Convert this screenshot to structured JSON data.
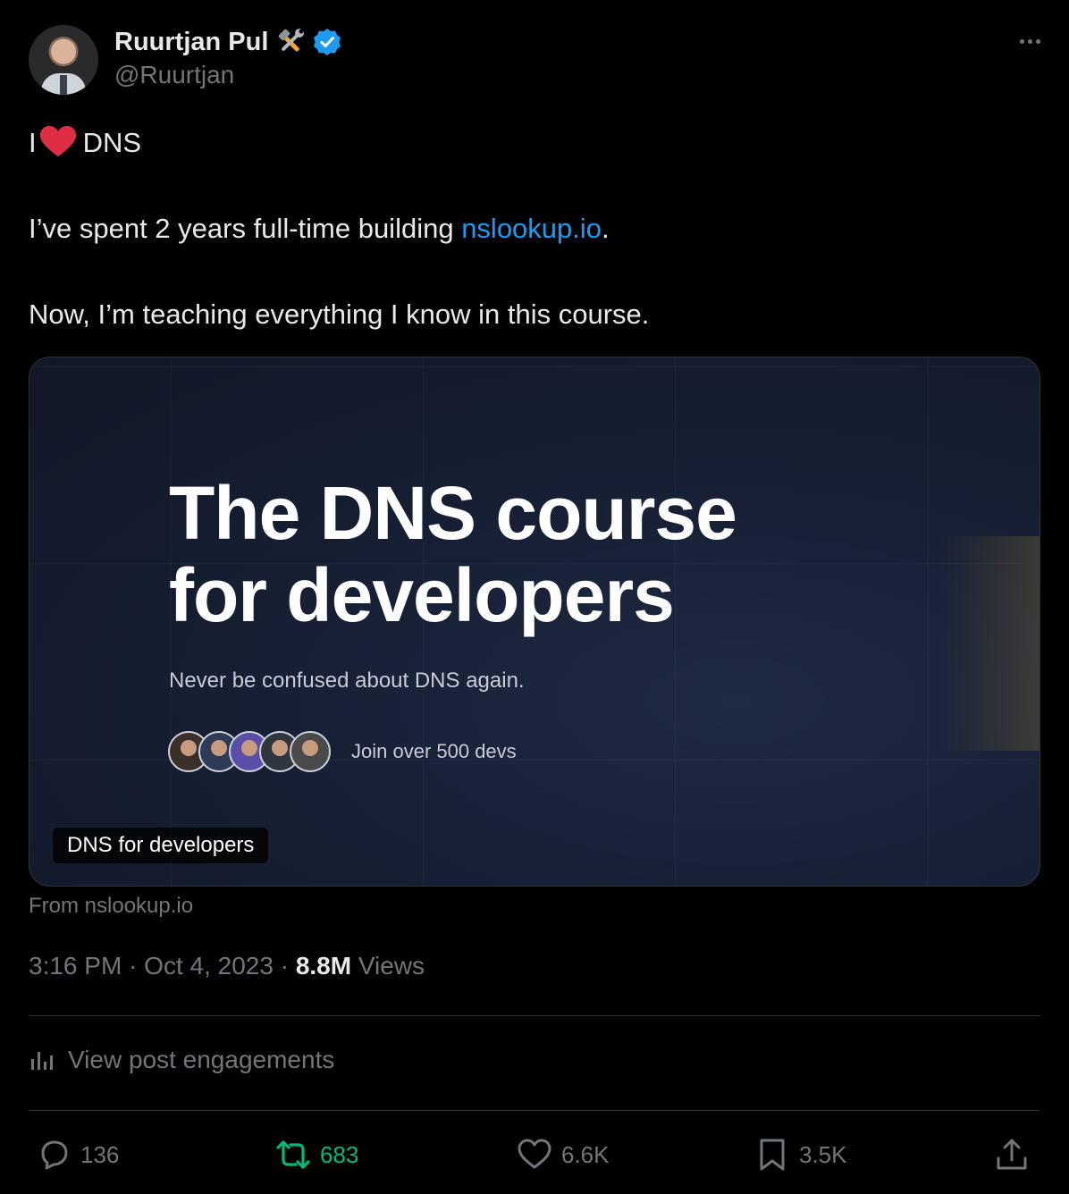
{
  "author": {
    "display_name": "Ruurtjan Pul",
    "handle": "@Ruurtjan",
    "name_emoji": "hammer-and-wrench-icon",
    "verified": true,
    "verified_color": "#1d9bf0"
  },
  "tweet": {
    "line1_start": "I",
    "line1_emoji": "red-heart-icon",
    "line1_end": "DNS",
    "line2_start": "I’ve spent 2 years full-time building ",
    "line2_link": "nslookup.io",
    "line2_end": ".",
    "line3": "Now, I’m teaching everything I know in this course.",
    "link_color": "#1d9bf0"
  },
  "card": {
    "headline_line1": "The DNS course",
    "headline_line2": "for developers",
    "subtitle": "Never be confused about DNS again.",
    "social_proof": "Join over 500 devs",
    "label": "DNS for developers",
    "source": "From nslookup.io"
  },
  "meta": {
    "time": "3:16 PM",
    "separator": "·",
    "date": "Oct 4, 2023",
    "views_count": "8.8M",
    "views_label": "Views"
  },
  "engagements": {
    "label": "View post engagements"
  },
  "actions": {
    "replies": "136",
    "reposts": "683",
    "likes": "6.6K",
    "bookmarks": "3.5K",
    "repost_color": "#00ba7c"
  }
}
